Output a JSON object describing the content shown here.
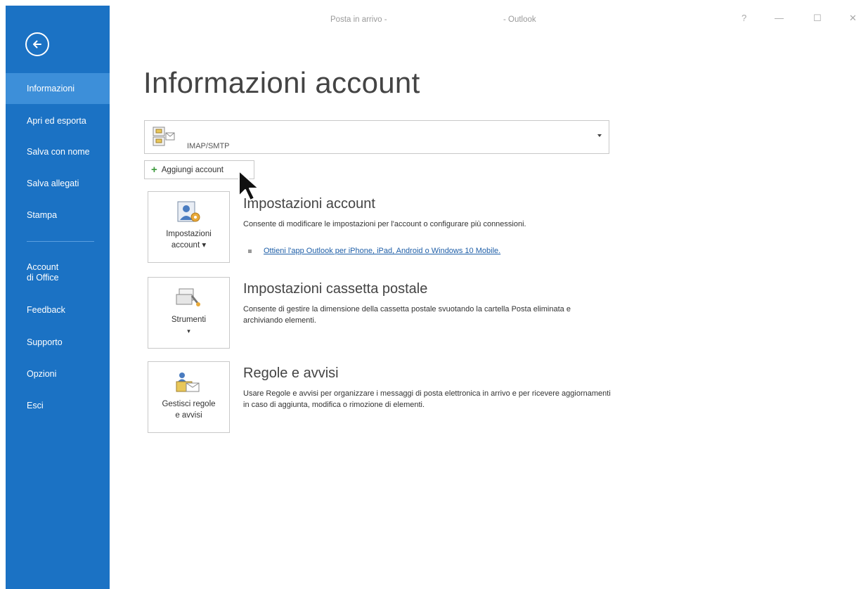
{
  "titlebar": {
    "left_text": "Posta in arrivo -",
    "app_name": "- Outlook",
    "help": "?",
    "minimize": "—",
    "maximize": "☐",
    "close": "✕"
  },
  "sidebar": {
    "accent_color": "#1b72c4",
    "items": [
      {
        "label": "Informazioni",
        "active": true
      },
      {
        "label": "Apri ed esporta"
      },
      {
        "label": "Salva con nome"
      },
      {
        "label": "Salva allegati"
      },
      {
        "label": "Stampa"
      },
      {
        "label": "Account\ndi Office"
      },
      {
        "label": "Feedback"
      },
      {
        "label": "Supporto"
      },
      {
        "label": "Opzioni"
      },
      {
        "label": "Esci"
      }
    ]
  },
  "main": {
    "title": "Informazioni account",
    "account_select": {
      "value": "IMAP/SMTP"
    },
    "add_account_label": "Aggiungi account",
    "sections": [
      {
        "tile_label_1": "Impostazioni",
        "tile_label_2": "account ▾",
        "title": "Impostazioni account",
        "description": "Consente di modificare le impostazioni per l'account o configurare più connessioni.",
        "link": "Ottieni l'app Outlook per iPhone, iPad, Android o Windows 10 Mobile."
      },
      {
        "tile_label_1": "Strumenti",
        "tile_label_2": "▾",
        "title": "Impostazioni cassetta postale",
        "description": "Consente di gestire la dimensione della cassetta postale svuotando la cartella Posta eliminata e archiviando elementi."
      },
      {
        "tile_label_1": "Gestisci regole",
        "tile_label_2": "e avvisi",
        "title": "Regole e avvisi",
        "description": "Usare Regole e avvisi per organizzare i messaggi di posta elettronica in arrivo e per ricevere aggiornamenti in caso di aggiunta, modifica o rimozione di elementi."
      }
    ]
  }
}
